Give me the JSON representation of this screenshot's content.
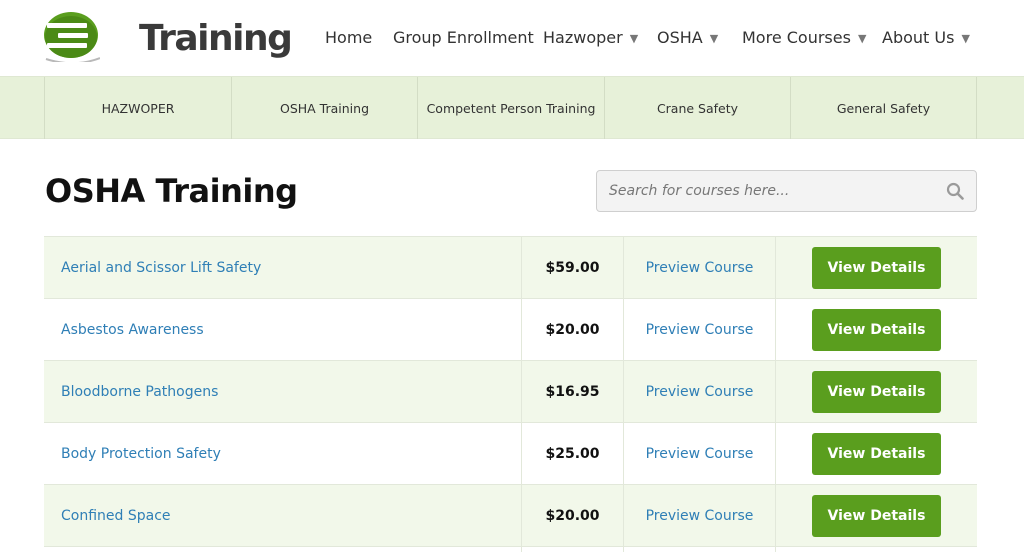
{
  "brand": {
    "name": "Training",
    "accent": "#5a9e1e",
    "logo_icon": "e-logo-icon"
  },
  "nav": {
    "items": [
      {
        "label": "Home",
        "has_dropdown": false
      },
      {
        "label": "Group Enrollment",
        "has_dropdown": false
      },
      {
        "label": "Hazwoper",
        "has_dropdown": true
      },
      {
        "label": "OSHA",
        "has_dropdown": true
      },
      {
        "label": "More Courses",
        "has_dropdown": true
      },
      {
        "label": "About Us",
        "has_dropdown": true
      }
    ],
    "caret": "▼"
  },
  "categories": [
    "HAZWOPER",
    "OSHA Training",
    "Competent Person Training",
    "Crane Safety",
    "General Safety"
  ],
  "page": {
    "title": "OSHA Training"
  },
  "search": {
    "placeholder": "Search for courses here...",
    "icon": "search-icon"
  },
  "courses": [
    {
      "name": "Aerial and Scissor Lift Safety",
      "price": "$59.00",
      "preview": "Preview Course",
      "action": "View Details"
    },
    {
      "name": "Asbestos Awareness",
      "price": "$20.00",
      "preview": "Preview Course",
      "action": "View Details"
    },
    {
      "name": "Bloodborne Pathogens",
      "price": "$16.95",
      "preview": "Preview Course",
      "action": "View Details"
    },
    {
      "name": "Body Protection Safety",
      "price": "$25.00",
      "preview": "Preview Course",
      "action": "View Details"
    },
    {
      "name": "Confined Space",
      "price": "$20.00",
      "preview": "Preview Course",
      "action": "View Details"
    }
  ]
}
